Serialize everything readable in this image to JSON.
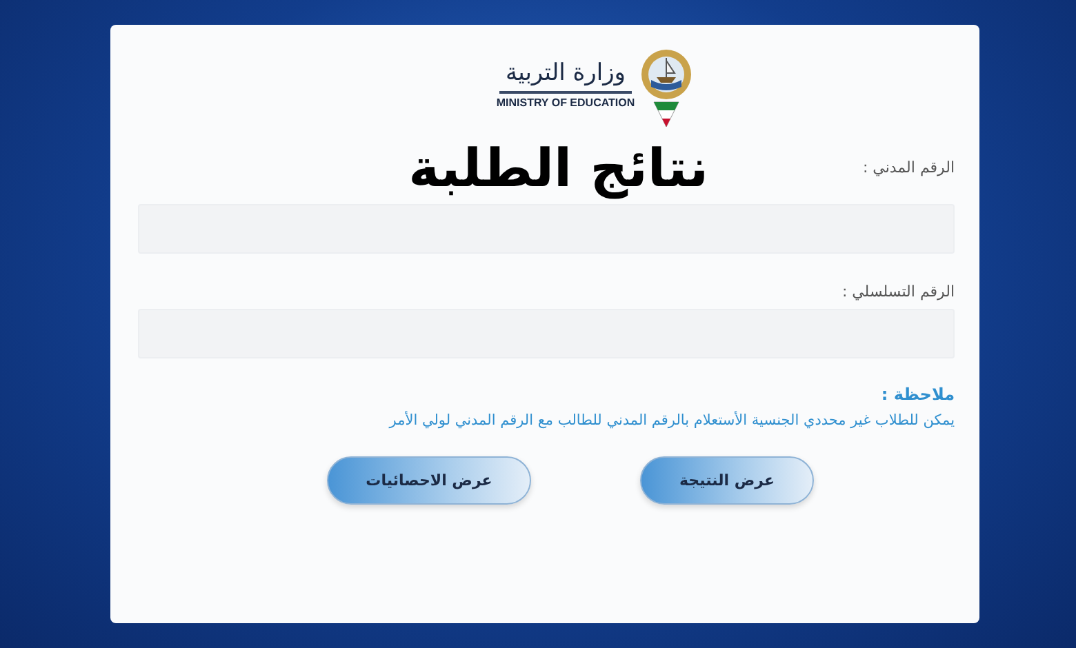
{
  "logo": {
    "arabic": "وزارة التربية",
    "english": "MINISTRY OF EDUCATION"
  },
  "title": "نتائج الطلبة",
  "fields": [
    {
      "label": "الرقم المدني :"
    },
    {
      "label": "الرقم التسلسلي :"
    }
  ],
  "note": {
    "heading": "ملاحظة :",
    "text": "يمكن للطلاب غير محددي الجنسية الأستعلام بالرقم المدني للطالب مع الرقم المدني لولي الأمر"
  },
  "buttons": [
    "عرض النتيجة",
    "عرض الاحصائيات"
  ]
}
